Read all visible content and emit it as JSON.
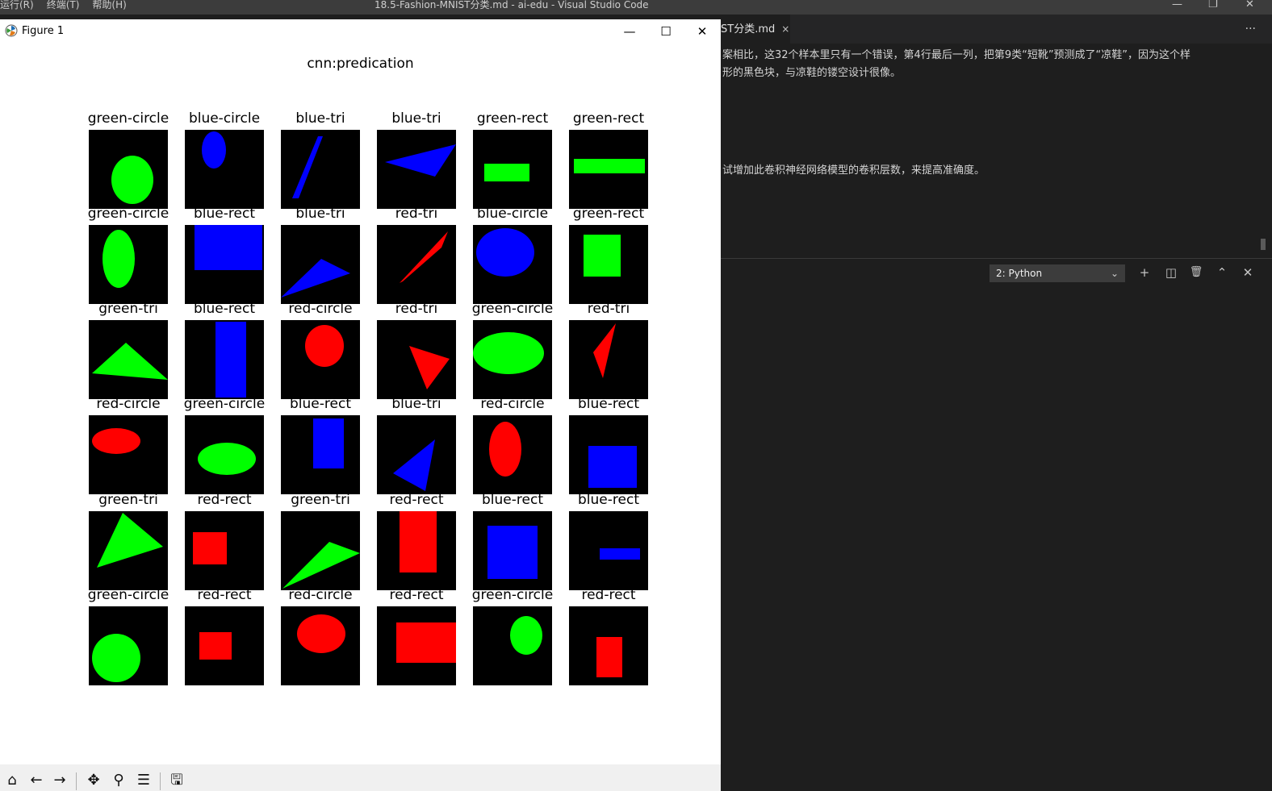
{
  "vscode": {
    "menu": [
      "运行(R)",
      "终端(T)",
      "帮助(H)"
    ],
    "window_title": "18.5-Fashion-MNIST分类.md - ai-edu - Visual Studio Code",
    "tab_label": "ST分类.md",
    "tab_close": "×",
    "more_actions": "···",
    "md_lines": [
      "案相比，这32个样本里只有一个错误，第4行最后一列，把第9类“短靴”预测成了“凉鞋”，因为这个样",
      "形的黑色块，与凉鞋的镂空设计很像。",
      "试增加此卷积神经网络模型的卷积层数，来提高准确度。"
    ],
    "terminal_select": "2: Python",
    "panel_buttons": [
      "+",
      "◫",
      "🗑",
      "⌃",
      "✕"
    ]
  },
  "figure": {
    "window_title": "Figure 1",
    "controls": [
      "—",
      "☐",
      "✕"
    ],
    "title": "cnn:predication",
    "labels": [
      [
        "green-circle",
        "blue-circle",
        "blue-tri",
        "blue-tri",
        "green-rect",
        "green-rect"
      ],
      [
        "green-circle",
        "blue-rect",
        "blue-tri",
        "red-tri",
        "blue-circle",
        "green-rect"
      ],
      [
        "green-tri",
        "blue-rect",
        "red-circle",
        "red-tri",
        "green-circle",
        "red-tri"
      ],
      [
        "red-circle",
        "green-circle",
        "blue-rect",
        "blue-tri",
        "red-circle",
        "blue-rect"
      ],
      [
        "green-tri",
        "red-rect",
        "green-tri",
        "red-rect",
        "blue-rect",
        "blue-rect"
      ],
      [
        "green-circle",
        "red-rect",
        "red-circle",
        "red-rect",
        "green-circle",
        "red-rect"
      ]
    ],
    "toolbar": [
      "home-icon",
      "back-icon",
      "forward-icon",
      "pan-icon",
      "zoom-icon",
      "configure-icon",
      "save-icon"
    ],
    "colors": {
      "red": "#ff0000",
      "green": "#00ff00",
      "blue": "#0000ff",
      "cell_bg": "#000000"
    }
  }
}
